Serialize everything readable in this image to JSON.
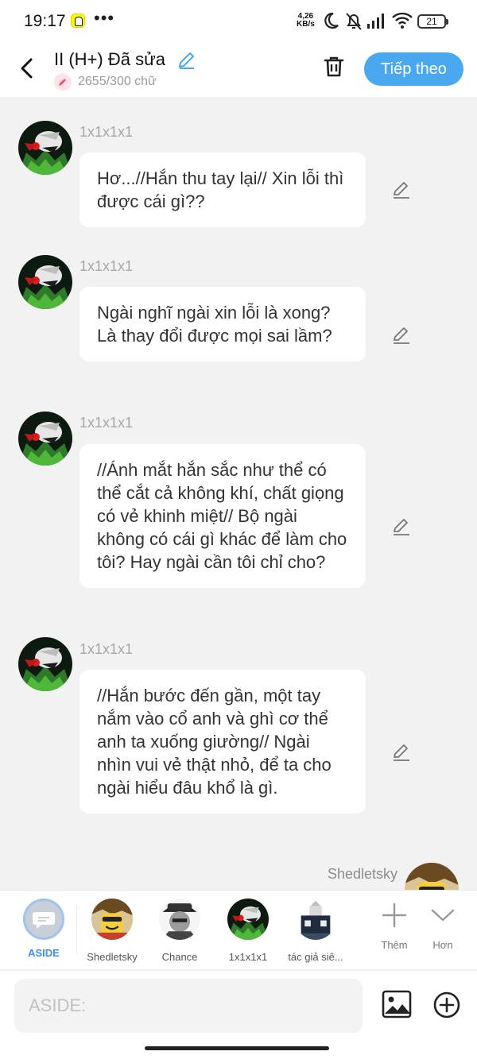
{
  "status_bar": {
    "time": "19:17",
    "net_speed_value": "4,26",
    "net_speed_unit": "KB/s",
    "battery": "21",
    "icons": [
      "snapchat-icon",
      "more-icon",
      "moon-icon",
      "bell-off-icon",
      "signal-icon",
      "wifi-icon",
      "battery-icon"
    ]
  },
  "header": {
    "title": "II (H+) Đã sửa",
    "char_count": "2655/300 chữ",
    "next_label": "Tiếp theo"
  },
  "messages": [
    {
      "sender": "1x1x1x1",
      "text": "Hơ...//Hắn thu tay lại// Xin lỗi thì được cái gì??"
    },
    {
      "sender": "1x1x1x1",
      "text": "Ngài nghĩ ngài xin lỗi là xong? Là thay đổi được mọi sai lầm?"
    },
    {
      "sender": "1x1x1x1",
      "text": "//Ánh mắt hắn sắc như thể có thể cắt cả không khí, chất giọng có vẻ khinh miệt// Bộ ngài không có cái gì khác để làm cho tôi? Hay ngài cần tôi chỉ cho?"
    },
    {
      "sender": "1x1x1x1",
      "text": "//Hắn bước đến gần, một tay nắm vào cổ anh và ghì cơ thể anh ta xuống giường// Ngài nhìn vui vẻ thật nhỏ, để ta cho ngài hiểu đâu khổ là gì."
    }
  ],
  "partial_message": {
    "sender": "Shedletsky"
  },
  "character_bar": {
    "items": [
      {
        "label": "ASIDE"
      },
      {
        "label": "Shedletsky"
      },
      {
        "label": "Chance"
      },
      {
        "label": "1x1x1x1"
      },
      {
        "label": "tác giả siê..."
      }
    ],
    "more_label": "Thêm",
    "collapse_label": "Hơn"
  },
  "input": {
    "placeholder": "ASIDE:"
  },
  "colors": {
    "accent": "#4aa8f0",
    "aside_label": "#3b8fe6",
    "background": "#f2f2f2"
  }
}
